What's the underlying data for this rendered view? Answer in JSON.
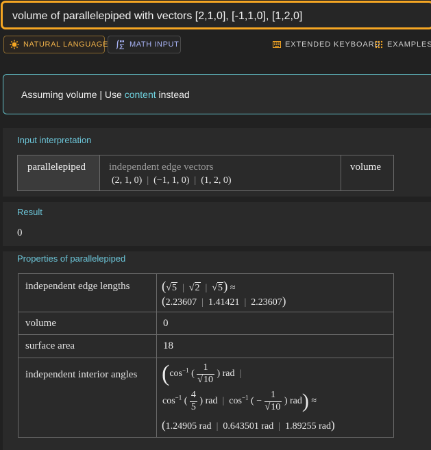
{
  "search": {
    "query": "volume of parallelepiped with vectors [2,1,0], [-1,1,0], [1,2,0]"
  },
  "input_modes": {
    "natural_language": "NATURAL LANGUAGE",
    "math_input": "MATH INPUT"
  },
  "toolbar": {
    "extended_keyboard": "EXTENDED KEYBOARD",
    "examples": "EXAMPLES"
  },
  "assumption": {
    "prefix": "Assuming volume | Use",
    "link": "content",
    "suffix": "instead"
  },
  "input_interpretation": {
    "title": "Input interpretation",
    "object": "parallelepiped",
    "param_label": "independent edge vectors",
    "vectors": [
      "(2, 1, 0)",
      "(−1, 1, 0)",
      "(1, 2, 0)"
    ],
    "property": "volume"
  },
  "result": {
    "title": "Result",
    "value": "0"
  },
  "properties": {
    "title": "Properties of parallelepiped",
    "rows": [
      {
        "label": "independent edge lengths",
        "exact": [
          "5",
          "2",
          "5"
        ],
        "approx": [
          "2.23607",
          "1.41421",
          "2.23607"
        ]
      },
      {
        "label": "volume",
        "value": "0"
      },
      {
        "label": "surface area",
        "value": "18"
      },
      {
        "label": "independent interior angles",
        "exact": {
          "a1": {
            "num": "1",
            "den_root": "10"
          },
          "a2": {
            "num": "4",
            "den": "5"
          },
          "a3": {
            "sign": "−",
            "num": "1",
            "den_root": "10"
          },
          "unit": "rad",
          "func": "cos"
        },
        "approx": [
          "1.24905 rad",
          "0.643501 rad",
          "1.89255 rad"
        ]
      }
    ]
  }
}
